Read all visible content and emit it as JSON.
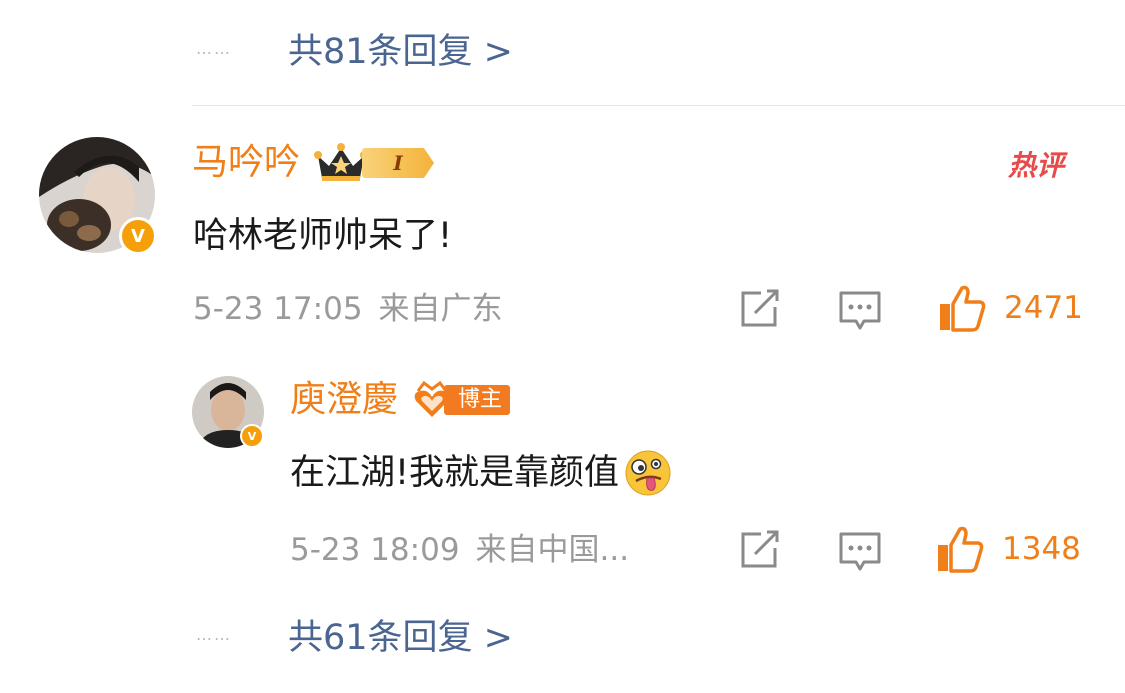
{
  "top_thread": {
    "dots": "……",
    "more_replies": "共81条回复 >"
  },
  "comment": {
    "username": "马吟吟",
    "level_label": "I",
    "hot_label": "热评",
    "text": "哈林老师帅呆了!",
    "time": "5-23 17:05",
    "location": "来自广东",
    "likes": "2471"
  },
  "reply": {
    "username": "庾澄慶",
    "badge_label": "博主",
    "text": "在江湖!我就是靠颜值",
    "emoji": "zany-face",
    "time": "5-23 18:09",
    "location": "来自中国...",
    "likes": "1348"
  },
  "bottom_thread": {
    "dots": "……",
    "more_replies": "共61条回复 >"
  },
  "colors": {
    "username": "#f07f1a",
    "link": "#4a6590",
    "meta": "#9a9a9a",
    "hot": "#e84a4a",
    "badge": "#f5a00a"
  },
  "icons": [
    "share-icon",
    "comment-icon",
    "like-icon",
    "crown-icon",
    "blogger-heart-icon",
    "verified-icon"
  ]
}
